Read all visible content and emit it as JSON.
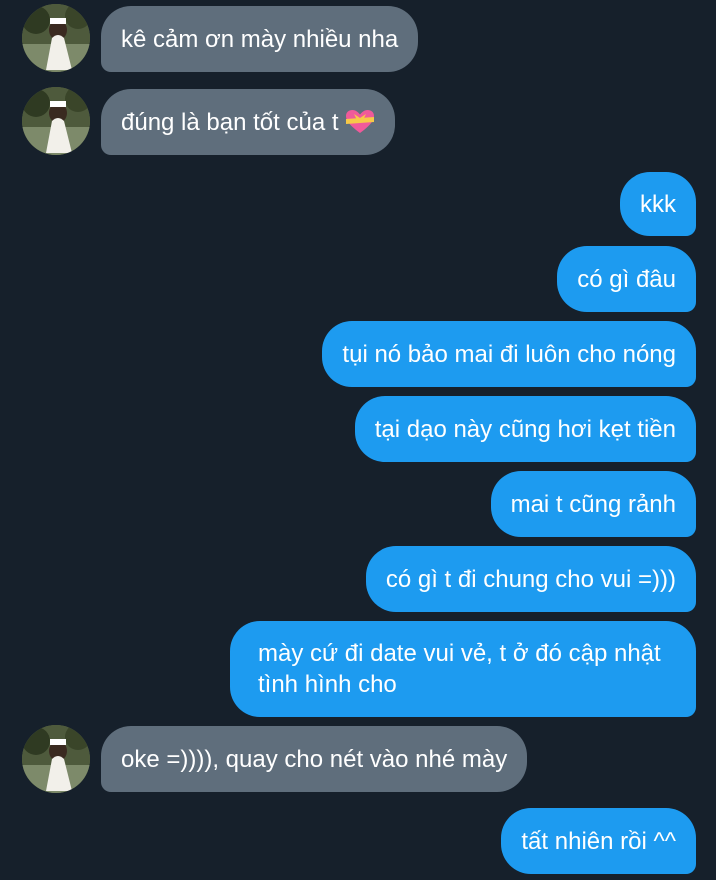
{
  "colors": {
    "background": "#16202b",
    "incoming_bubble": "#5f6e7c",
    "outgoing_bubble": "#1d9bf0",
    "text": "#ffffff"
  },
  "messages": [
    {
      "side": "incoming",
      "text": "kê cảm ơn mày nhiều nha",
      "avatar": true
    },
    {
      "side": "incoming",
      "text": "đúng là bạn tốt của t",
      "emoji": "heart-with-ribbon-icon",
      "avatar": true
    },
    {
      "side": "outgoing",
      "text": "kkk"
    },
    {
      "side": "outgoing",
      "text": "có gì đâu"
    },
    {
      "side": "outgoing",
      "text": "tụi nó bảo mai đi luôn cho nóng"
    },
    {
      "side": "outgoing",
      "text": "tại dạo này cũng hơi kẹt tiền"
    },
    {
      "side": "outgoing",
      "text": "mai t cũng rảnh"
    },
    {
      "side": "outgoing",
      "text": "có gì t đi chung cho vui =)))"
    },
    {
      "side": "outgoing",
      "text": "mày cứ đi date vui vẻ, t ở đó cập nhật tình hình cho"
    },
    {
      "side": "incoming",
      "text": "oke =)))), quay cho nét vào nhé mày",
      "avatar": true
    },
    {
      "side": "outgoing",
      "text": "tất nhiên rồi ^^"
    }
  ]
}
